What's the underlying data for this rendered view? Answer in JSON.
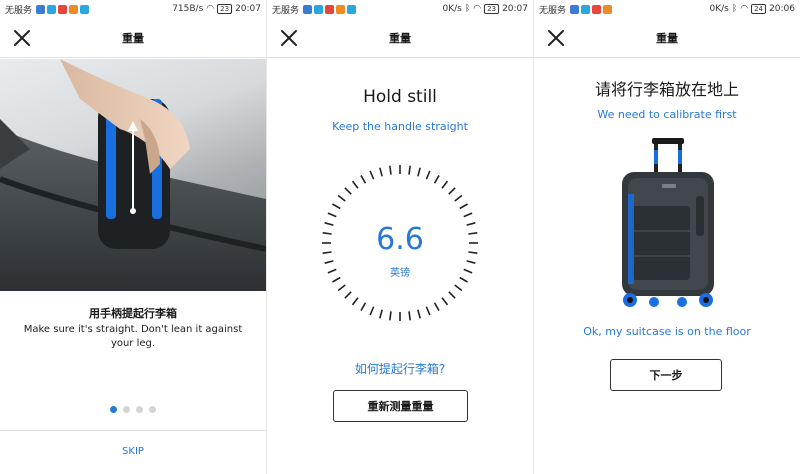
{
  "panels": [
    {
      "status": {
        "carrier": "无服务",
        "speed": "715B/s",
        "battery": "23",
        "time": "20:07"
      },
      "title": "重量",
      "subtitle": "用手柄提起行李箱",
      "body": "Make sure it's straight. Don't lean it against your leg.",
      "pager": {
        "count": 4,
        "active_index": 0
      },
      "skip_label": "SKIP"
    },
    {
      "status": {
        "carrier": "无服务",
        "speed": "0K/s",
        "battery": "23",
        "time": "20:07"
      },
      "title": "重量",
      "headline": "Hold still",
      "hint": "Keep the handle straight",
      "reading": "6.6",
      "unit": "英镑",
      "help_link": "如何提起行李箱?",
      "button_label": "重新测量重量"
    },
    {
      "status": {
        "carrier": "无服务",
        "speed": "0K/s",
        "battery": "24",
        "time": "20:06"
      },
      "title": "重量",
      "headline": "请将行李箱放在地上",
      "hint": "We need to calibrate first",
      "confirm_link": "Ok, my suitcase is on the floor",
      "button_label": "下一步"
    }
  ],
  "colors": {
    "accent": "#2878d8",
    "text": "#1a1a1a",
    "divider": "#e3e3e3"
  },
  "icons": {
    "close": "close-icon"
  }
}
